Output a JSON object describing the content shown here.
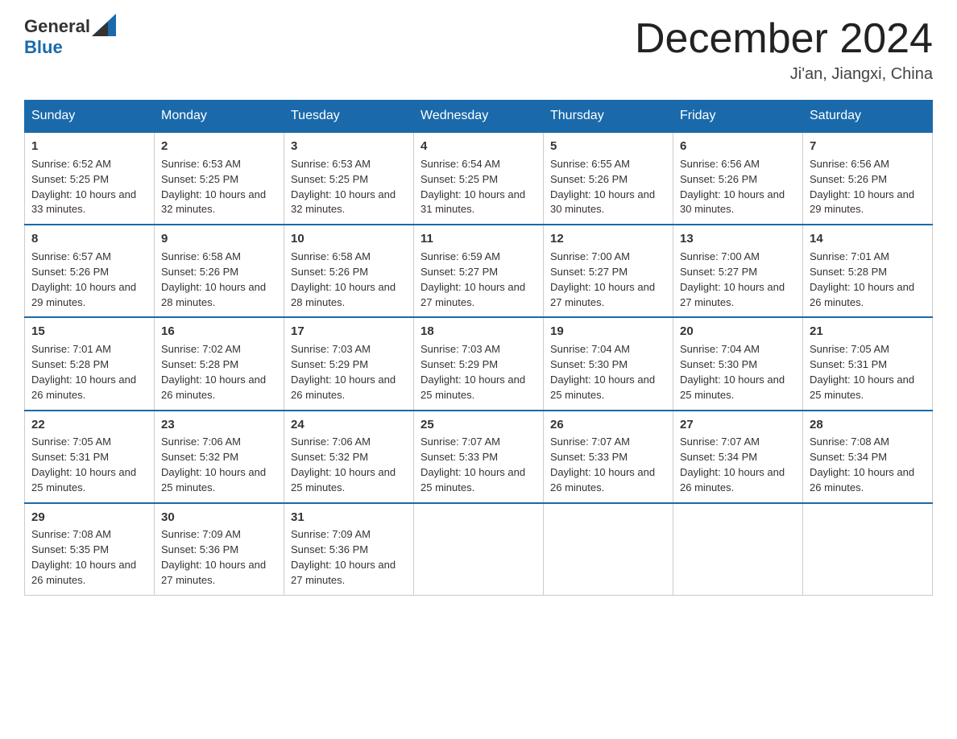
{
  "header": {
    "logo_general": "General",
    "logo_blue": "Blue",
    "month_title": "December 2024",
    "location": "Ji'an, Jiangxi, China"
  },
  "weekdays": [
    "Sunday",
    "Monday",
    "Tuesday",
    "Wednesday",
    "Thursday",
    "Friday",
    "Saturday"
  ],
  "weeks": [
    [
      {
        "day": "1",
        "sunrise": "6:52 AM",
        "sunset": "5:25 PM",
        "daylight": "10 hours and 33 minutes."
      },
      {
        "day": "2",
        "sunrise": "6:53 AM",
        "sunset": "5:25 PM",
        "daylight": "10 hours and 32 minutes."
      },
      {
        "day": "3",
        "sunrise": "6:53 AM",
        "sunset": "5:25 PM",
        "daylight": "10 hours and 32 minutes."
      },
      {
        "day": "4",
        "sunrise": "6:54 AM",
        "sunset": "5:25 PM",
        "daylight": "10 hours and 31 minutes."
      },
      {
        "day": "5",
        "sunrise": "6:55 AM",
        "sunset": "5:26 PM",
        "daylight": "10 hours and 30 minutes."
      },
      {
        "day": "6",
        "sunrise": "6:56 AM",
        "sunset": "5:26 PM",
        "daylight": "10 hours and 30 minutes."
      },
      {
        "day": "7",
        "sunrise": "6:56 AM",
        "sunset": "5:26 PM",
        "daylight": "10 hours and 29 minutes."
      }
    ],
    [
      {
        "day": "8",
        "sunrise": "6:57 AM",
        "sunset": "5:26 PM",
        "daylight": "10 hours and 29 minutes."
      },
      {
        "day": "9",
        "sunrise": "6:58 AM",
        "sunset": "5:26 PM",
        "daylight": "10 hours and 28 minutes."
      },
      {
        "day": "10",
        "sunrise": "6:58 AM",
        "sunset": "5:26 PM",
        "daylight": "10 hours and 28 minutes."
      },
      {
        "day": "11",
        "sunrise": "6:59 AM",
        "sunset": "5:27 PM",
        "daylight": "10 hours and 27 minutes."
      },
      {
        "day": "12",
        "sunrise": "7:00 AM",
        "sunset": "5:27 PM",
        "daylight": "10 hours and 27 minutes."
      },
      {
        "day": "13",
        "sunrise": "7:00 AM",
        "sunset": "5:27 PM",
        "daylight": "10 hours and 27 minutes."
      },
      {
        "day": "14",
        "sunrise": "7:01 AM",
        "sunset": "5:28 PM",
        "daylight": "10 hours and 26 minutes."
      }
    ],
    [
      {
        "day": "15",
        "sunrise": "7:01 AM",
        "sunset": "5:28 PM",
        "daylight": "10 hours and 26 minutes."
      },
      {
        "day": "16",
        "sunrise": "7:02 AM",
        "sunset": "5:28 PM",
        "daylight": "10 hours and 26 minutes."
      },
      {
        "day": "17",
        "sunrise": "7:03 AM",
        "sunset": "5:29 PM",
        "daylight": "10 hours and 26 minutes."
      },
      {
        "day": "18",
        "sunrise": "7:03 AM",
        "sunset": "5:29 PM",
        "daylight": "10 hours and 25 minutes."
      },
      {
        "day": "19",
        "sunrise": "7:04 AM",
        "sunset": "5:30 PM",
        "daylight": "10 hours and 25 minutes."
      },
      {
        "day": "20",
        "sunrise": "7:04 AM",
        "sunset": "5:30 PM",
        "daylight": "10 hours and 25 minutes."
      },
      {
        "day": "21",
        "sunrise": "7:05 AM",
        "sunset": "5:31 PM",
        "daylight": "10 hours and 25 minutes."
      }
    ],
    [
      {
        "day": "22",
        "sunrise": "7:05 AM",
        "sunset": "5:31 PM",
        "daylight": "10 hours and 25 minutes."
      },
      {
        "day": "23",
        "sunrise": "7:06 AM",
        "sunset": "5:32 PM",
        "daylight": "10 hours and 25 minutes."
      },
      {
        "day": "24",
        "sunrise": "7:06 AM",
        "sunset": "5:32 PM",
        "daylight": "10 hours and 25 minutes."
      },
      {
        "day": "25",
        "sunrise": "7:07 AM",
        "sunset": "5:33 PM",
        "daylight": "10 hours and 25 minutes."
      },
      {
        "day": "26",
        "sunrise": "7:07 AM",
        "sunset": "5:33 PM",
        "daylight": "10 hours and 26 minutes."
      },
      {
        "day": "27",
        "sunrise": "7:07 AM",
        "sunset": "5:34 PM",
        "daylight": "10 hours and 26 minutes."
      },
      {
        "day": "28",
        "sunrise": "7:08 AM",
        "sunset": "5:34 PM",
        "daylight": "10 hours and 26 minutes."
      }
    ],
    [
      {
        "day": "29",
        "sunrise": "7:08 AM",
        "sunset": "5:35 PM",
        "daylight": "10 hours and 26 minutes."
      },
      {
        "day": "30",
        "sunrise": "7:09 AM",
        "sunset": "5:36 PM",
        "daylight": "10 hours and 27 minutes."
      },
      {
        "day": "31",
        "sunrise": "7:09 AM",
        "sunset": "5:36 PM",
        "daylight": "10 hours and 27 minutes."
      },
      null,
      null,
      null,
      null
    ]
  ],
  "labels": {
    "sunrise": "Sunrise:",
    "sunset": "Sunset:",
    "daylight": "Daylight:"
  }
}
